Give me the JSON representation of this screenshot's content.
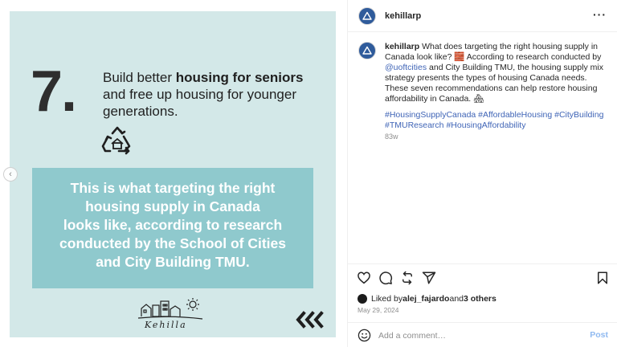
{
  "post": {
    "number": "7.",
    "headline_pre": "Build better ",
    "headline_bold": "housing for seniors",
    "headline_post": " and free up housing for younger generations.",
    "callout_line1_pre": "This is what ",
    "callout_line1_bold": "targeting the right",
    "callout_line2": "housing supply in Canada",
    "callout_line3": "looks like, according to research",
    "callout_line4": "conducted by the School of Cities",
    "callout_line5": "and City Building TMU.",
    "logo_text": "Kehilla"
  },
  "header": {
    "username": "kehillarp",
    "more": "···"
  },
  "caption": {
    "username": "kehillarp",
    "text_1": " What does targeting the right housing supply in Canada look like? 🧱 According to research conducted by ",
    "mention": "@uoftcities",
    "text_2": " and City Building TMU, the housing supply mix strategy presents the types of housing Canada needs. These seven recommendations can help restore housing affordability in Canada. 🏘",
    "hashtags": "#HousingSupplyCanada #AffordableHousing #CityBuilding #TMUResearch #HousingAffordability",
    "age": "83w"
  },
  "likes": {
    "prefix": "Liked by ",
    "user": "alej_fajardo",
    "middle": " and ",
    "others": "3 others"
  },
  "date": "May 29, 2024",
  "comment": {
    "placeholder": "Add a comment…",
    "post_label": "Post"
  }
}
